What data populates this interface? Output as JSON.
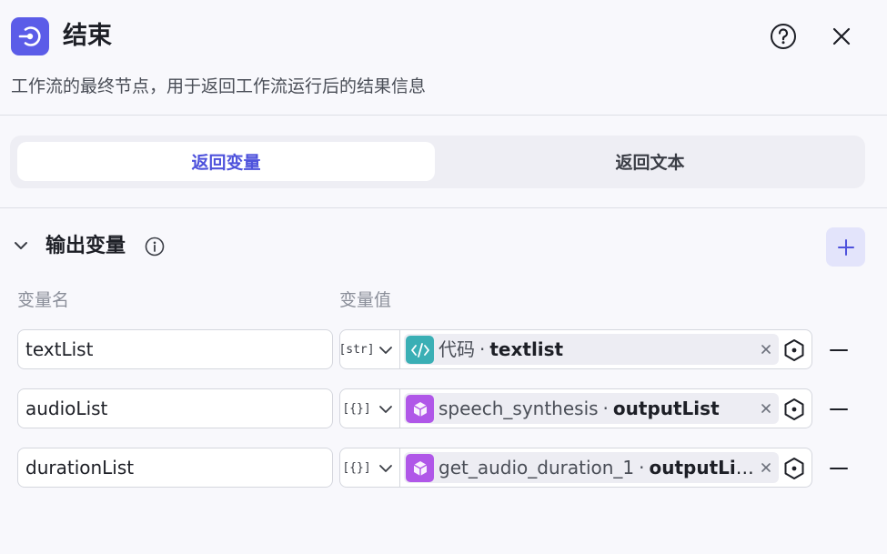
{
  "header": {
    "title": "结束",
    "description": "工作流的最终节点，用于返回工作流运行后的结果信息"
  },
  "tabs": [
    {
      "label": "返回变量",
      "active": true
    },
    {
      "label": "返回文本",
      "active": false
    }
  ],
  "section": {
    "title": "输出变量",
    "col_name": "变量名",
    "col_value": "变量值"
  },
  "rows": [
    {
      "name": "textList",
      "type": "[str]",
      "node": "代码",
      "separator": "·",
      "var": "textlist",
      "node_icon": "code-icon"
    },
    {
      "name": "audioList",
      "type": "[{}]",
      "node": "speech_synthesis",
      "separator": "·",
      "var": "outputList",
      "node_icon": "plugin-cube-icon"
    },
    {
      "name": "durationList",
      "type": "[{}]",
      "node": "get_audio_duration_1",
      "separator": "·",
      "var": "outputList",
      "node_icon": "plugin-cube-icon"
    }
  ],
  "colors": {
    "accent": "#4e52dc",
    "logo_bg": "#5b5ce8",
    "code_icon_bg": "#3aafb5",
    "plugin_icon_bg": "#b057e8"
  }
}
